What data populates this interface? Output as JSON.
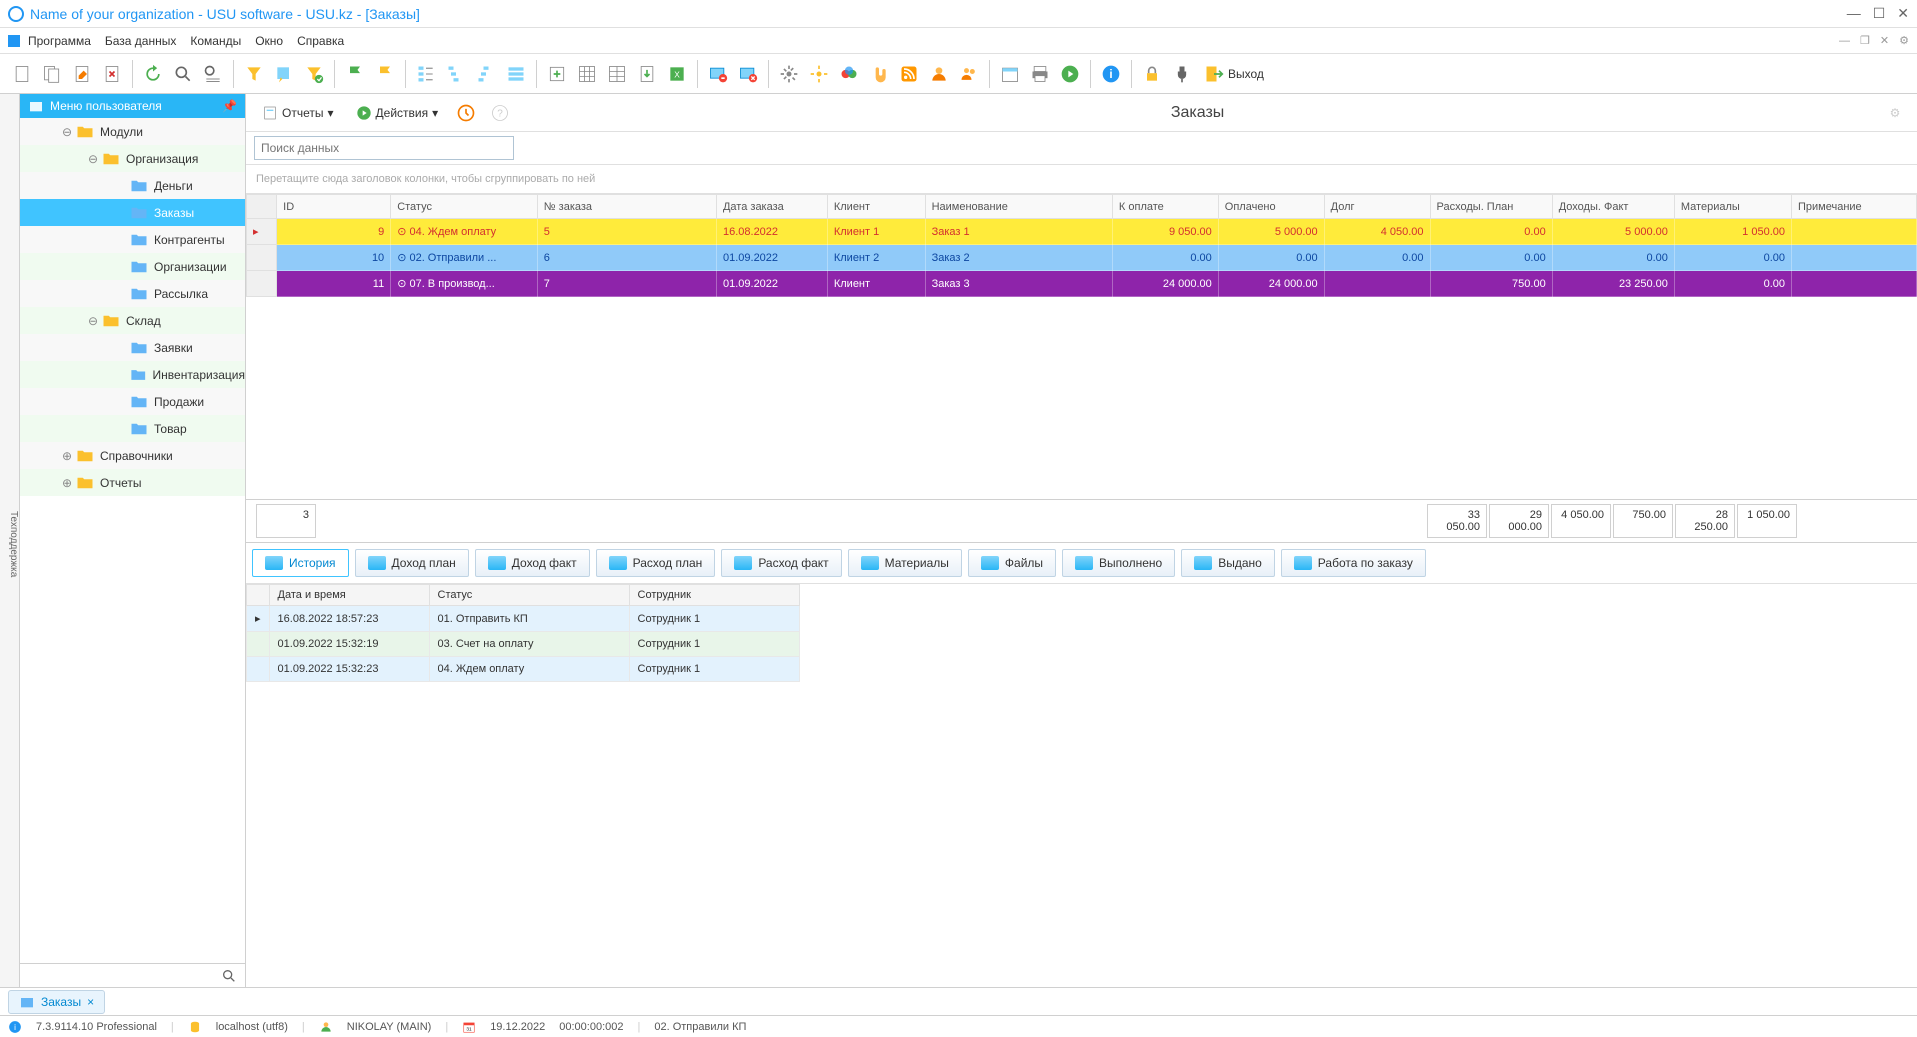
{
  "title": "Name of your organization - USU software - USU.kz - [Заказы]",
  "menubar": [
    "Программа",
    "База данных",
    "Команды",
    "Окно",
    "Справка"
  ],
  "toolbar_exit": "Выход",
  "side_tab": "Техподдержка",
  "sidebar": {
    "title": "Меню пользователя",
    "items": [
      {
        "level": 1,
        "label": "Модули",
        "expand": "⊖",
        "folder": "yellow"
      },
      {
        "level": 2,
        "label": "Организация",
        "expand": "⊖",
        "folder": "yellow"
      },
      {
        "level": 3,
        "label": "Деньги",
        "folder": "blue"
      },
      {
        "level": 3,
        "label": "Заказы",
        "folder": "blue",
        "selected": true
      },
      {
        "level": 3,
        "label": "Контрагенты",
        "folder": "blue"
      },
      {
        "level": 3,
        "label": "Организации",
        "folder": "blue"
      },
      {
        "level": 3,
        "label": "Рассылка",
        "folder": "blue"
      },
      {
        "level": 2,
        "label": "Склад",
        "expand": "⊖",
        "folder": "yellow"
      },
      {
        "level": 3,
        "label": "Заявки",
        "folder": "blue"
      },
      {
        "level": 3,
        "label": "Инвентаризация",
        "folder": "blue"
      },
      {
        "level": 3,
        "label": "Продажи",
        "folder": "blue"
      },
      {
        "level": 3,
        "label": "Товар",
        "folder": "blue"
      },
      {
        "level": 1,
        "label": "Справочники",
        "expand": "⊕",
        "folder": "yellow"
      },
      {
        "level": 1,
        "label": "Отчеты",
        "expand": "⊕",
        "folder": "yellow"
      }
    ]
  },
  "content": {
    "reports_btn": "Отчеты",
    "actions_btn": "Действия",
    "page_title": "Заказы",
    "search_placeholder": "Поиск данных",
    "group_hint": "Перетащите сюда заголовок колонки, чтобы сгруппировать по ней",
    "columns": [
      "ID",
      "Статус",
      "№ заказа",
      "Дата заказа",
      "Клиент",
      "Наименование",
      "К оплате",
      "Оплачено",
      "Долг",
      "Расходы. План",
      "Доходы. Факт",
      "Материалы",
      "Примечание"
    ],
    "rows": [
      {
        "style": "yellow",
        "id": "9",
        "status": "04. Ждем оплату",
        "num": "5",
        "date": "16.08.2022",
        "client": "Клиент 1",
        "name": "Заказ 1",
        "pay": "9 050.00",
        "paid": "5 000.00",
        "debt": "4 050.00",
        "exp": "0.00",
        "inc": "5 000.00",
        "mat": "1 050.00",
        "note": ""
      },
      {
        "style": "blue",
        "id": "10",
        "status": "02. Отправили ...",
        "num": "6",
        "date": "01.09.2022",
        "client": "Клиент 2",
        "name": "Заказ 2",
        "pay": "0.00",
        "paid": "0.00",
        "debt": "0.00",
        "exp": "0.00",
        "inc": "0.00",
        "mat": "0.00",
        "note": ""
      },
      {
        "style": "purple",
        "id": "11",
        "status": "07. В производ...",
        "num": "7",
        "date": "01.09.2022",
        "client": "Клиент",
        "name": "Заказ 3",
        "pay": "24 000.00",
        "paid": "24 000.00",
        "debt": "",
        "exp": "750.00",
        "inc": "23 250.00",
        "mat": "0.00",
        "note": ""
      }
    ],
    "totals": {
      "count": "3",
      "pay": "33 050.00",
      "paid": "29 000.00",
      "debt": "4 050.00",
      "exp": "750.00",
      "inc": "28 250.00",
      "mat": "1 050.00"
    },
    "tabs": [
      "История",
      "Доход план",
      "Доход факт",
      "Расход план",
      "Расход факт",
      "Материалы",
      "Файлы",
      "Выполнено",
      "Выдано",
      "Работа по заказу"
    ],
    "detail_columns": [
      "Дата и время",
      "Статус",
      "Сотрудник"
    ],
    "detail_rows": [
      {
        "dt": "16.08.2022 18:57:23",
        "status": "01. Отправить КП",
        "emp": "Сотрудник 1"
      },
      {
        "dt": "01.09.2022 15:32:19",
        "status": "03. Счет на оплату",
        "emp": "Сотрудник 1"
      },
      {
        "dt": "01.09.2022 15:32:23",
        "status": "04. Ждем оплату",
        "emp": "Сотрудник 1"
      }
    ]
  },
  "window_tab": "Заказы",
  "statusbar": {
    "version": "7.3.9114.10 Professional",
    "host": "localhost (utf8)",
    "user": "NIKOLAY (MAIN)",
    "date": "19.12.2022",
    "time": "00:00:00:002",
    "status": "02. Отправили КП"
  }
}
